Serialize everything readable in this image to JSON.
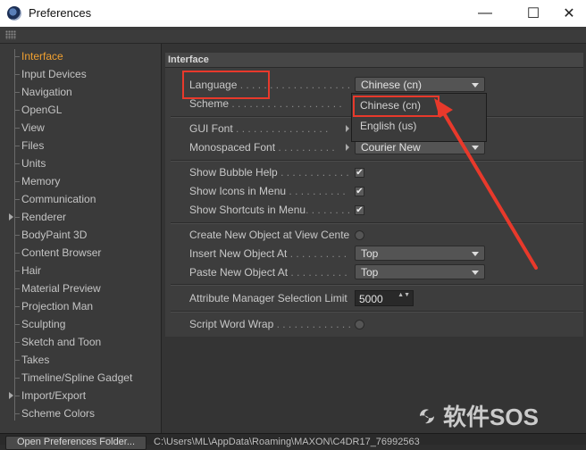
{
  "window": {
    "title": "Preferences",
    "minimize": "—",
    "maximize": "☐",
    "close": "✕"
  },
  "sidebar": {
    "items": [
      {
        "label": "Interface",
        "active": true,
        "expandable": false
      },
      {
        "label": "Input Devices",
        "expandable": false
      },
      {
        "label": "Navigation",
        "expandable": false
      },
      {
        "label": "OpenGL",
        "expandable": false
      },
      {
        "label": "View",
        "expandable": false
      },
      {
        "label": "Files",
        "expandable": false
      },
      {
        "label": "Units",
        "expandable": false
      },
      {
        "label": "Memory",
        "expandable": false
      },
      {
        "label": "Communication",
        "expandable": false
      },
      {
        "label": "Renderer",
        "expandable": true
      },
      {
        "label": "BodyPaint 3D",
        "expandable": false
      },
      {
        "label": "Content Browser",
        "expandable": false
      },
      {
        "label": "Hair",
        "expandable": false
      },
      {
        "label": "Material Preview",
        "expandable": false
      },
      {
        "label": "Projection Man",
        "expandable": false
      },
      {
        "label": "Sculpting",
        "expandable": false
      },
      {
        "label": "Sketch and Toon",
        "expandable": false
      },
      {
        "label": "Takes",
        "expandable": false
      },
      {
        "label": "Timeline/Spline Gadget",
        "expandable": false
      },
      {
        "label": "Import/Export",
        "expandable": true
      },
      {
        "label": "Scheme Colors",
        "expandable": false
      }
    ]
  },
  "panel": {
    "title": "Interface",
    "language": {
      "label": "Language",
      "dots": " . . . . . . . . . . . . . . . . . . .",
      "value": "Chinese (cn)"
    },
    "scheme": {
      "label": "Scheme",
      "dots": " . . . . . . . . . . . . . . . . . . ."
    },
    "gui_font": {
      "label": "GUI Font",
      "dots": " . . . . . . . . . . . . . . . ."
    },
    "mono_font": {
      "label": "Monospaced Font",
      "dots": " . . . . . . . . . .",
      "value": "Courier New"
    },
    "bubble_help": {
      "label": "Show Bubble Help",
      "dots": " . . . . . . . . . . . .",
      "checked": true,
      "mark": "✔"
    },
    "icons_menu": {
      "label": "Show Icons in Menu",
      "dots": " . . . . . . . . . .",
      "checked": true,
      "mark": "✔"
    },
    "shortcuts_menu": {
      "label": "Show Shortcuts in Menu",
      "dots": ". . . . . . . .",
      "checked": true,
      "mark": "✔"
    },
    "create_at_view": {
      "label": "Create New Object at View Center"
    },
    "insert_at": {
      "label": "Insert New Object At",
      "dots": " . . . . . . . . . . .",
      "value": "Top"
    },
    "paste_at": {
      "label": "Paste New Object At",
      "dots": " . . . . . . . . . . . .",
      "value": "Top"
    },
    "attr_limit": {
      "label": "Attribute Manager Selection Limit",
      "value": "5000",
      "spin": "▲▼"
    },
    "word_wrap": {
      "label": "Script Word Wrap",
      "dots": " . . . . . . . . . . . . . ."
    }
  },
  "language_menu": {
    "options": [
      "Chinese (cn)",
      "English (us)"
    ],
    "selected": "Chinese (cn)"
  },
  "status": {
    "button": "Open Preferences Folder...",
    "path": "C:\\Users\\ML\\AppData\\Roaming\\MAXON\\C4DR17_76992563"
  },
  "watermark": {
    "text": "软件SOS"
  },
  "colors": {
    "accent": "#f0a030",
    "annotation": "#e8392b"
  }
}
